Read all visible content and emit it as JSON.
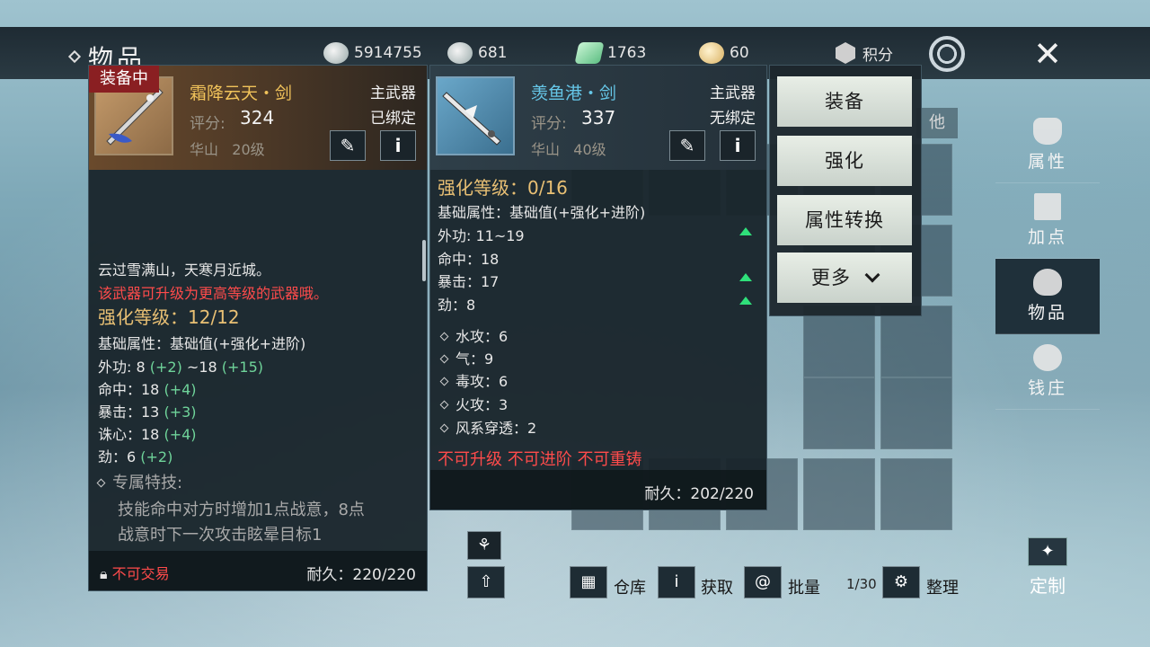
{
  "header": {
    "title": "物品",
    "currencies": [
      {
        "icon": "coin-icon",
        "value": "5914755"
      },
      {
        "icon": "silver-ingot-icon",
        "value": "681"
      },
      {
        "icon": "jade-icon",
        "value": "1763"
      },
      {
        "icon": "gold-ingot-icon",
        "value": "60"
      }
    ],
    "score_label": "积分"
  },
  "left_item": {
    "tag": "装备中",
    "name": "霜降云天・剑",
    "slot": "主武器",
    "bind": "已绑定",
    "score_label": "评分:",
    "score": "324",
    "school": "华山",
    "level": "20级",
    "flavor": "云过雪满山，天寒月近城。",
    "notice": "该武器可升级为更高等级的武器哦。",
    "enhance": "强化等级：12/12",
    "base_title": "基础属性：基础值(+强化+进阶)",
    "stats": [
      {
        "label": "外功: 8",
        "bonus": "(+2)",
        "rest": " ~18 ",
        "bonus2": "(+15)"
      },
      {
        "label": "命中：18 ",
        "bonus": "(+4)",
        "rest": "",
        "bonus2": ""
      },
      {
        "label": "暴击：13 ",
        "bonus": "(+3)",
        "rest": "",
        "bonus2": ""
      },
      {
        "label": "诛心：18 ",
        "bonus": "(+4)",
        "rest": "",
        "bonus2": ""
      },
      {
        "label": "劲：6 ",
        "bonus": "(+2)",
        "rest": "",
        "bonus2": ""
      }
    ],
    "skill_title": "专属特技:",
    "skill_lines": [
      "技能命中对方时增加1点战意，8点",
      "战意时下一次攻击眩晕目标1"
    ],
    "trade": "不可交易",
    "durability": "耐久：220/220"
  },
  "mid_item": {
    "name": "羡鱼港・剑",
    "slot": "主武器",
    "bind": "无绑定",
    "score_label": "评分:",
    "score": "337",
    "school": "华山",
    "level": "40级",
    "enhance": "强化等级：0/16",
    "base_title": "基础属性：基础值(+强化+进阶)",
    "stats": [
      "外功: 11~19",
      "命中：18",
      "暴击：17",
      "劲：8"
    ],
    "extra": [
      "水攻：6",
      "气：9",
      "毒攻：6",
      "火攻：3",
      "风系穿透：2"
    ],
    "restrict": "不可升级 不可进阶 不可重铸",
    "durability": "耐久：202/220"
  },
  "menu": [
    "装备",
    "强化",
    "属性转换",
    "更多"
  ],
  "nav": [
    "属性",
    "加点",
    "物品",
    "钱庄"
  ],
  "custom": "定制",
  "bottom": {
    "warehouse": "仓库",
    "obtain": "获取",
    "batch": "批量",
    "page": "1/30",
    "sort": "整理"
  },
  "other_tab": "他",
  "colors": {
    "gold": "#f0c25a",
    "cyan": "#66c7e8",
    "red": "#ff4b4b",
    "green": "#6fd49a",
    "tag": "#8a1f22"
  }
}
